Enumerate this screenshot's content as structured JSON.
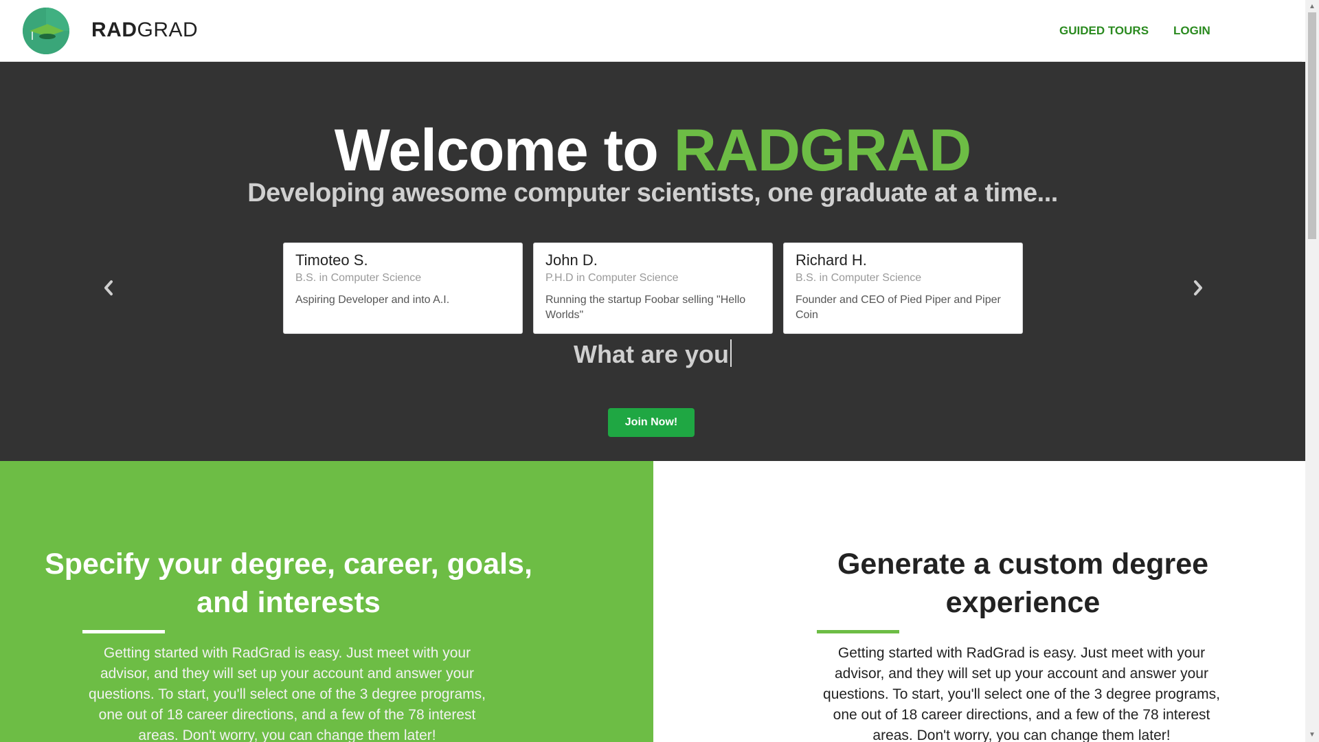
{
  "header": {
    "brand_bold": "RAD",
    "brand_light": "GRAD",
    "nav": [
      {
        "label": "GUIDED TOURS"
      },
      {
        "label": "LOGIN"
      }
    ]
  },
  "hero": {
    "title_prefix": "Welcome to ",
    "title_accent": "RADGRAD",
    "subtitle": "Developing awesome computer scientists, one graduate at a time...",
    "typing_text": "What are you",
    "join_label": "Join Now!",
    "testimonials": [
      {
        "name": "Timoteo S.",
        "degree": "B.S. in Computer Science",
        "text": "Aspiring Developer and into A.I."
      },
      {
        "name": "John D.",
        "degree": "P.H.D in Computer Science",
        "text": "Running the startup Foobar selling \"Hello Worlds\""
      },
      {
        "name": "Richard H.",
        "degree": "B.S. in Computer Science",
        "text": "Founder and CEO of Pied Piper and Piper Coin"
      }
    ]
  },
  "features": [
    {
      "title": "Specify your degree, career, goals, and interests",
      "text": "Getting started with RadGrad is easy. Just meet with your advisor, and they will set up your account and answer your questions. To start, you'll select one of the 3 degree programs, one out of 18 career directions, and a few of the 78 interest areas. Don't worry, you can change them later!"
    },
    {
      "title": "Generate a custom degree experience",
      "text": "Getting started with RadGrad is easy. Just meet with your advisor, and they will set up your account and answer your questions. To start, you'll select one of the 3 degree programs, one out of 18 career directions, and a few of the 78 interest areas. Don't worry, you can change them later!"
    }
  ],
  "colors": {
    "accent_green": "#6dbd45",
    "hero_bg": "#333333",
    "button_green": "#1fa743",
    "nav_link": "#2a8a1f"
  },
  "icons": [
    "graduation-cap-logo-icon",
    "chevron-left-icon",
    "chevron-right-icon"
  ]
}
